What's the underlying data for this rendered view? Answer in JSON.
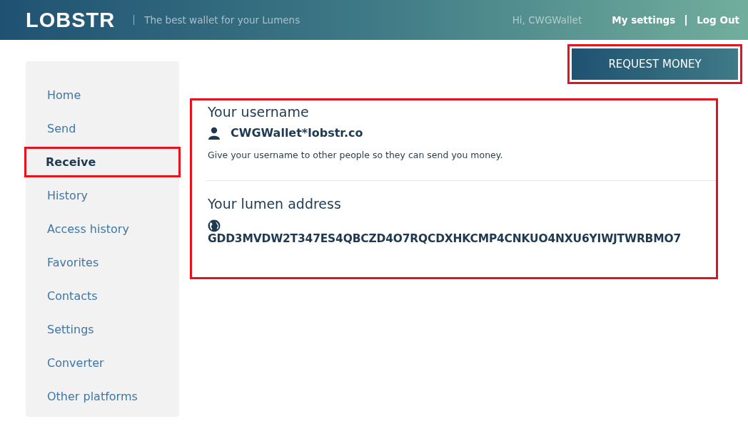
{
  "header": {
    "logo": "LOBSTR",
    "tagline": "The best wallet for your Lumens",
    "greeting": "Hi, CWGWallet",
    "links": [
      "My settings",
      "Log Out"
    ]
  },
  "sidebar": {
    "items": [
      {
        "label": "Home",
        "selected": false,
        "highlighted": false
      },
      {
        "label": "Send",
        "selected": false,
        "highlighted": false
      },
      {
        "label": "Receive",
        "selected": true,
        "highlighted": true
      },
      {
        "label": "History",
        "selected": false,
        "highlighted": false
      },
      {
        "label": "Access history",
        "selected": false,
        "highlighted": false
      },
      {
        "label": "Favorites",
        "selected": false,
        "highlighted": false
      },
      {
        "label": "Contacts",
        "selected": false,
        "highlighted": false
      },
      {
        "label": "Settings",
        "selected": false,
        "highlighted": false
      },
      {
        "label": "Converter",
        "selected": false,
        "highlighted": false
      },
      {
        "label": "Other platforms",
        "selected": false,
        "highlighted": false
      }
    ]
  },
  "request_button": {
    "label": "REQUEST MONEY",
    "highlighted": true
  },
  "card": {
    "highlighted": true,
    "username": {
      "heading": "Your username",
      "value": "CWGWallet*lobstr.co",
      "hint": "Give your username to other people so they can send you money."
    },
    "address": {
      "heading": "Your lumen address",
      "value": "GDD3MVDW2T347ES4QBCZD4O7RQCDXHKCMP4CNKUO4NXU6YIWJTWRBMO7"
    }
  }
}
